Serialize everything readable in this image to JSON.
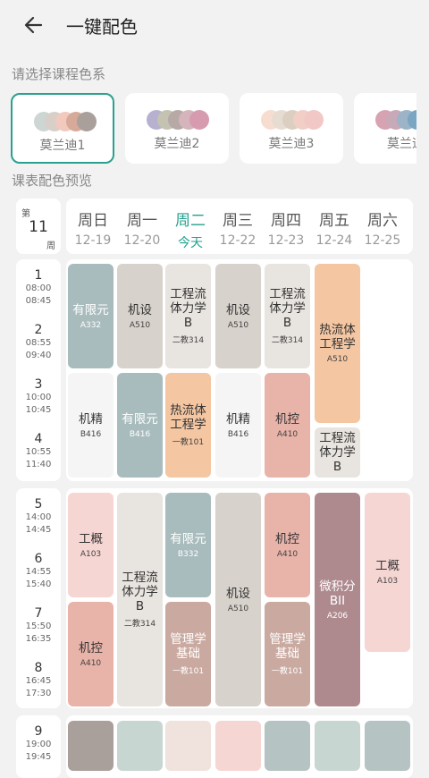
{
  "header": {
    "title": "一键配色"
  },
  "labels": {
    "choose_scheme": "请选择课程色系",
    "preview": "课表配色预览"
  },
  "schemes": [
    {
      "name": "莫兰迪1",
      "colors": [
        "#cdd6d2",
        "#d8cfc9",
        "#f2c9bd",
        "#d6a999",
        "#aaa09b"
      ]
    },
    {
      "name": "莫兰迪2",
      "colors": [
        "#b7b1cf",
        "#c4c2b0",
        "#b6a9a6",
        "#d5b4bb",
        "#d79bb0"
      ]
    },
    {
      "name": "莫兰迪3",
      "colors": [
        "#f7ddd0",
        "#e6dcd2",
        "#dccfc2",
        "#f1cfc6",
        "#f2c8c6"
      ]
    },
    {
      "name": "莫兰迪",
      "colors": [
        "#d7a3b3",
        "#c8a9b7",
        "#9cb3c8",
        "#7aa6c4"
      ]
    }
  ],
  "calendar": {
    "week_prefix": "第",
    "week_num": "11",
    "week_suffix": "周",
    "days": [
      {
        "name": "周日",
        "date": "12-19",
        "today": false
      },
      {
        "name": "周一",
        "date": "12-20",
        "today": false
      },
      {
        "name": "周二",
        "date": "今天",
        "today": true
      },
      {
        "name": "周三",
        "date": "12-22",
        "today": false
      },
      {
        "name": "周四",
        "date": "12-23",
        "today": false
      },
      {
        "name": "周五",
        "date": "12-24",
        "today": false
      },
      {
        "name": "周六",
        "date": "12-25",
        "today": false
      }
    ],
    "periods": [
      {
        "num": "1",
        "start": "08:00",
        "end": "08:45"
      },
      {
        "num": "2",
        "start": "08:55",
        "end": "09:40"
      },
      {
        "num": "3",
        "start": "10:00",
        "end": "10:45"
      },
      {
        "num": "4",
        "start": "10:55",
        "end": "11:40"
      },
      {
        "num": "5",
        "start": "14:00",
        "end": "14:45"
      },
      {
        "num": "6",
        "start": "14:55",
        "end": "15:40"
      },
      {
        "num": "7",
        "start": "15:50",
        "end": "16:35"
      },
      {
        "num": "8",
        "start": "16:45",
        "end": "17:30"
      },
      {
        "num": "9",
        "start": "19:00",
        "end": "19:45"
      }
    ]
  },
  "courses": [
    {
      "day": 0,
      "start": 1,
      "span": 2,
      "name": "有限元",
      "room": "A332",
      "color": "#a9bcbd",
      "text": "light"
    },
    {
      "day": 1,
      "start": 1,
      "span": 2,
      "name": "机设",
      "room": "A510",
      "color": "#d7d2cb",
      "text": "dark"
    },
    {
      "day": 2,
      "start": 1,
      "span": 2,
      "name": "工程流体力学B",
      "room": "二教314",
      "color": "#e8e4df",
      "text": "dark"
    },
    {
      "day": 3,
      "start": 1,
      "span": 2,
      "name": "机设",
      "room": "A510",
      "color": "#d7d2cb",
      "text": "dark"
    },
    {
      "day": 4,
      "start": 1,
      "span": 2,
      "name": "工程流体力学B",
      "room": "二教314",
      "color": "#e8e4df",
      "text": "dark"
    },
    {
      "day": 5,
      "start": 1,
      "span": 3,
      "name": "热流体工程学",
      "room": "A510",
      "color": "#f4c6a2",
      "text": "dark"
    },
    {
      "day": 0,
      "start": 3,
      "span": 2,
      "name": "机精",
      "room": "B416",
      "color": "#f5f5f5",
      "text": "dark"
    },
    {
      "day": 1,
      "start": 3,
      "span": 2,
      "name": "有限元",
      "room": "B416",
      "color": "#a9bcbd",
      "text": "light"
    },
    {
      "day": 2,
      "start": 3,
      "span": 2,
      "name": "热流体工程学",
      "room": "一教101",
      "color": "#f4c6a2",
      "text": "dark"
    },
    {
      "day": 3,
      "start": 3,
      "span": 2,
      "name": "机精",
      "room": "B416",
      "color": "#f5f5f5",
      "text": "dark"
    },
    {
      "day": 4,
      "start": 3,
      "span": 2,
      "name": "机控",
      "room": "A410",
      "color": "#e8b3a9",
      "text": "dark"
    },
    {
      "day": 5,
      "start": 4,
      "span": 1,
      "name": "工程流体力学B",
      "room": "",
      "color": "#e8e4df",
      "text": "dark"
    },
    {
      "day": 0,
      "start": 5,
      "span": 2,
      "name": "工概",
      "room": "A103",
      "color": "#f6d6d3",
      "text": "dark"
    },
    {
      "day": 1,
      "start": 5,
      "span": 4,
      "name": "工程流体力学B",
      "room": "二教314",
      "color": "#e8e4df",
      "text": "dark"
    },
    {
      "day": 2,
      "start": 5,
      "span": 2,
      "name": "有限元",
      "room": "B332",
      "color": "#a9bcbd",
      "text": "light"
    },
    {
      "day": 3,
      "start": 5,
      "span": 4,
      "name": "机设",
      "room": "A510",
      "color": "#d7d2cb",
      "text": "dark"
    },
    {
      "day": 4,
      "start": 5,
      "span": 2,
      "name": "机控",
      "room": "A410",
      "color": "#e8b3a9",
      "text": "dark"
    },
    {
      "day": 5,
      "start": 5,
      "span": 4,
      "name": "微积分BII",
      "room": "A206",
      "color": "#ae8a8f",
      "text": "light"
    },
    {
      "day": 6,
      "start": 5,
      "span": 3,
      "name": "工概",
      "room": "A103",
      "color": "#f6d6d3",
      "text": "dark"
    },
    {
      "day": 0,
      "start": 7,
      "span": 2,
      "name": "机控",
      "room": "A410",
      "color": "#e8b3a9",
      "text": "dark"
    },
    {
      "day": 2,
      "start": 7,
      "span": 2,
      "name": "管理学基础",
      "room": "一教101",
      "color": "#c9a9a0",
      "text": "light"
    },
    {
      "day": 4,
      "start": 7,
      "span": 2,
      "name": "管理学基础",
      "room": "一教101",
      "color": "#c9a9a0",
      "text": "light"
    },
    {
      "day": 0,
      "start": 9,
      "span": 1,
      "name": "",
      "room": "",
      "color": "#aaa09b",
      "text": "dark"
    },
    {
      "day": 1,
      "start": 9,
      "span": 1,
      "name": "",
      "room": "",
      "color": "#c8d6d2",
      "text": "dark"
    },
    {
      "day": 2,
      "start": 9,
      "span": 1,
      "name": "",
      "room": "",
      "color": "#f0e2dc",
      "text": "dark"
    },
    {
      "day": 3,
      "start": 9,
      "span": 1,
      "name": "",
      "room": "",
      "color": "#f6d6d3",
      "text": "dark"
    },
    {
      "day": 4,
      "start": 9,
      "span": 1,
      "name": "",
      "room": "",
      "color": "#b5c3c3",
      "text": "dark"
    },
    {
      "day": 5,
      "start": 9,
      "span": 1,
      "name": "",
      "room": "",
      "color": "#c8d6d2",
      "text": "dark"
    },
    {
      "day": 6,
      "start": 9,
      "span": 1,
      "name": "",
      "room": "",
      "color": "#b5c3c3",
      "text": "dark"
    }
  ]
}
